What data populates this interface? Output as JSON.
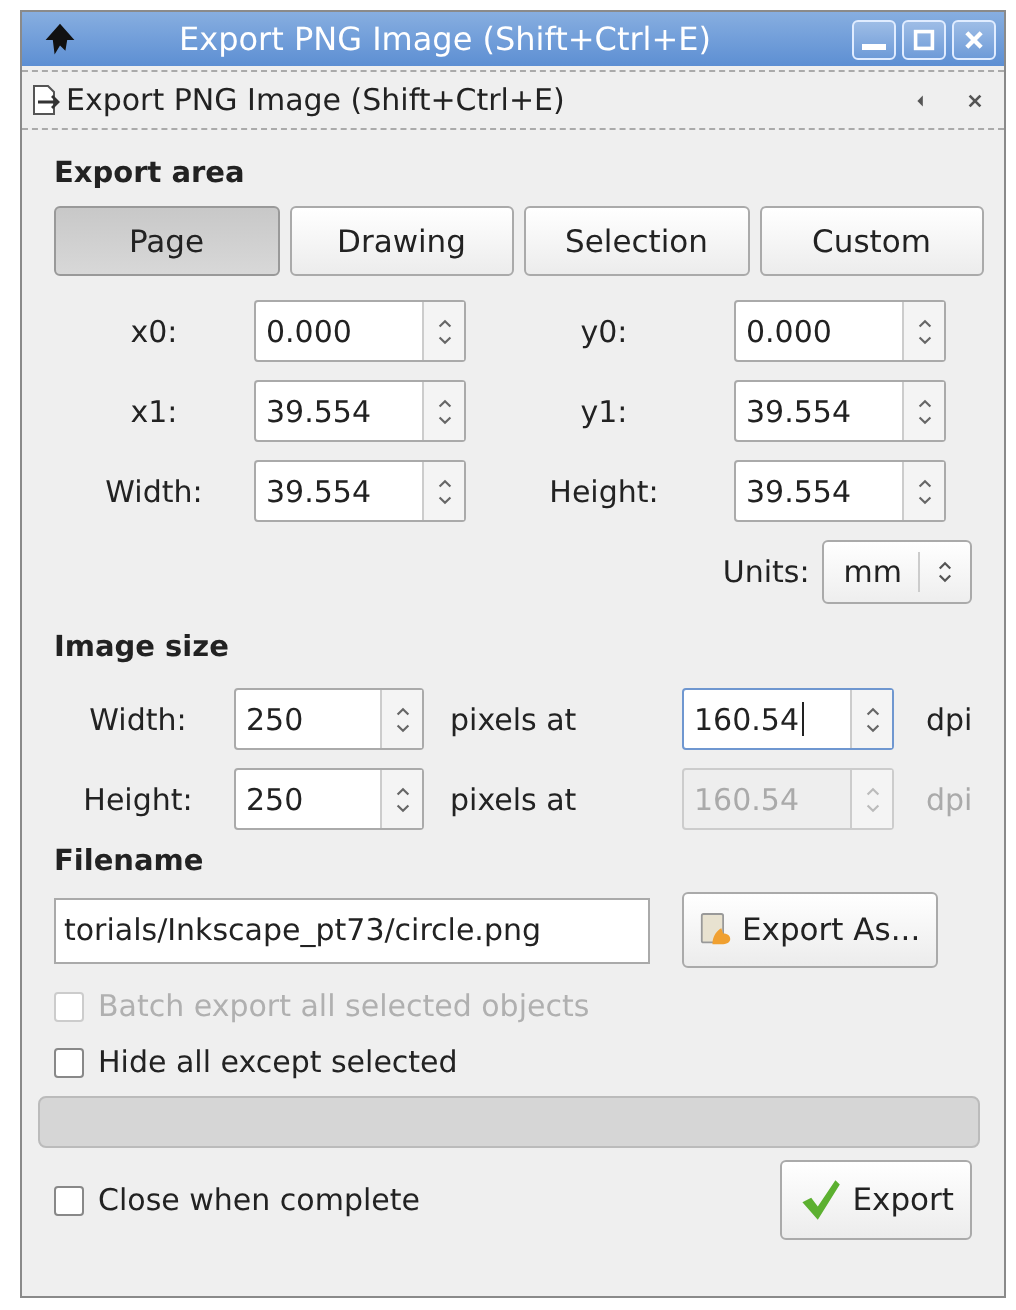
{
  "window": {
    "title": "Export PNG Image (Shift+Ctrl+E)"
  },
  "dock": {
    "title": "Export PNG Image (Shift+Ctrl+E)"
  },
  "export_area": {
    "heading": "Export area",
    "tabs": [
      {
        "label": "Page",
        "selected": true
      },
      {
        "label": "Drawing",
        "selected": false
      },
      {
        "label": "Selection",
        "selected": false
      },
      {
        "label": "Custom",
        "selected": false
      }
    ],
    "fields": [
      {
        "label": "x0:",
        "value": "0.000"
      },
      {
        "label": "y0:",
        "value": "0.000"
      },
      {
        "label": "x1:",
        "value": "39.554"
      },
      {
        "label": "y1:",
        "value": "39.554"
      },
      {
        "label": "Width:",
        "value": "39.554"
      },
      {
        "label": "Height:",
        "value": "39.554"
      }
    ],
    "units": {
      "label": "Units:",
      "value": "mm"
    }
  },
  "image_size": {
    "heading": "Image size",
    "rows": [
      {
        "label": "Width:",
        "value": "250",
        "at": "pixels at",
        "dpi": {
          "value": "160.54",
          "focused": true,
          "disabled": false
        },
        "unit": "dpi"
      },
      {
        "label": "Height:",
        "value": "250",
        "at": "pixels at",
        "dpi": {
          "value": "160.54",
          "focused": false,
          "disabled": true
        },
        "unit": "dpi"
      }
    ]
  },
  "filename": {
    "heading": "Filename",
    "value": "torials/Inkscape_pt73/circle.png",
    "button": "Export As..."
  },
  "options": [
    {
      "label": "Batch export all selected objects",
      "checked": false,
      "disabled": true
    },
    {
      "label": "Hide all except selected",
      "checked": false,
      "disabled": false
    }
  ],
  "close_option": {
    "label": "Close when complete",
    "checked": false
  },
  "export_button": "Export"
}
